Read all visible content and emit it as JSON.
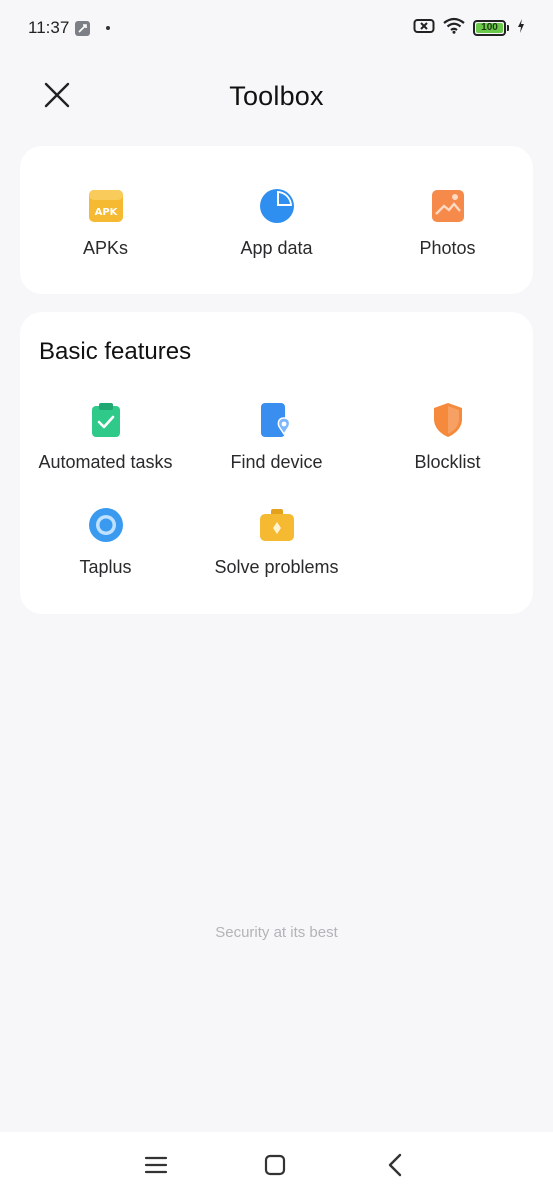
{
  "status_bar": {
    "time": "11:37",
    "battery_level": "100",
    "icons": [
      "app-notification-icon",
      "sim-off-icon",
      "wifi-icon",
      "battery-icon",
      "charging-icon"
    ]
  },
  "header": {
    "title": "Toolbox",
    "close_icon": "close-icon"
  },
  "storage_card": {
    "items": [
      {
        "label": "APKs",
        "icon": "apk-icon",
        "color": "#f5b932"
      },
      {
        "label": "App data",
        "icon": "pie-chart-icon",
        "color": "#2f8ff0"
      },
      {
        "label": "Photos",
        "icon": "photo-icon",
        "color": "#f58a4b"
      }
    ]
  },
  "basic_features": {
    "title": "Basic features",
    "items": [
      {
        "label": "Automated tasks",
        "icon": "clipboard-check-icon",
        "color": "#2fc98a"
      },
      {
        "label": "Find device",
        "icon": "find-device-icon",
        "color": "#3a8ef0"
      },
      {
        "label": "Blocklist",
        "icon": "shield-icon",
        "color": "#f58a3c"
      },
      {
        "label": "Taplus",
        "icon": "taplus-icon",
        "color": "#3a9af0"
      },
      {
        "label": "Solve problems",
        "icon": "toolkit-icon",
        "color": "#f5b932"
      }
    ]
  },
  "footer": {
    "text": "Security at its best"
  },
  "nav_bar": {
    "icons": [
      "menu-icon",
      "home-icon",
      "back-icon"
    ]
  }
}
